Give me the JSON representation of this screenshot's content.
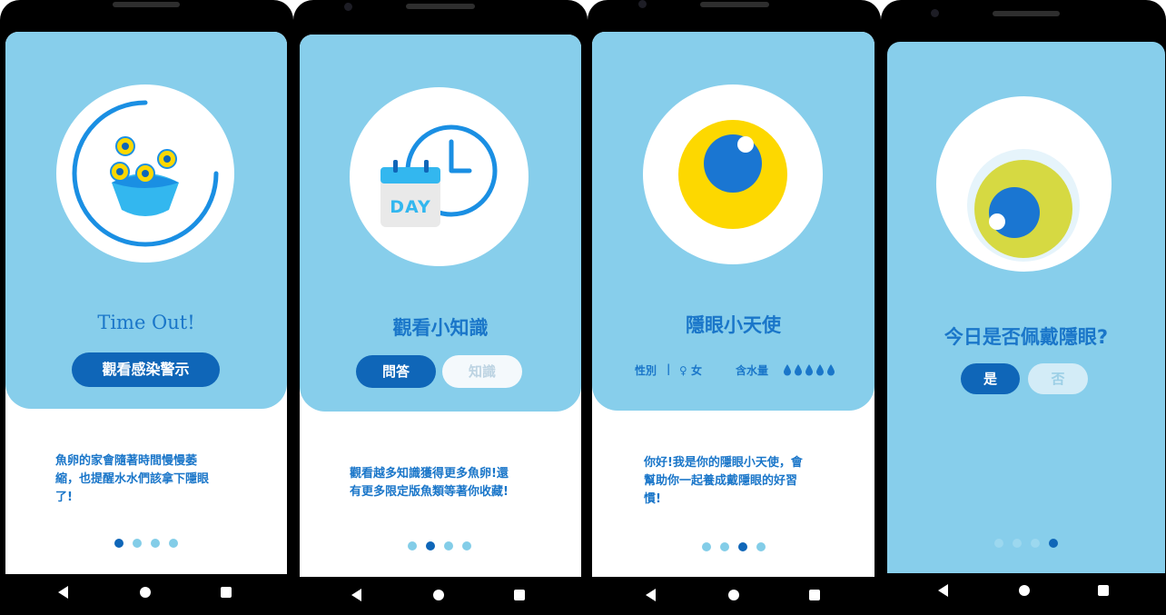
{
  "screens": [
    {
      "title": "Time Out!",
      "button": "觀看感染警示",
      "description": [
        "魚卵的家會隨著時間慢慢萎",
        "縮，也提醒水水們該拿下隱眼",
        "了!"
      ],
      "illustration": "fish-eggs-timer-icon",
      "active_page": 1
    },
    {
      "title": "觀看小知識",
      "buttons": [
        "問答",
        "知識"
      ],
      "description": [
        "觀看越多知識獲得更多魚卵!還",
        "有更多限定版魚類等著你收藏!"
      ],
      "calendar_label": "DAY",
      "illustration": "calendar-clock-icon",
      "active_page": 2
    },
    {
      "title": "隱眼小天使",
      "gender_label": "性別",
      "gender_value": "♀ 女",
      "water_label": "含水量",
      "water_drops": "💧💧💧💧💧",
      "description": [
        "你好!我是你的隱眼小天使，會",
        "幫助你一起養成戴隱眼的好習",
        "慣!"
      ],
      "illustration": "eye-icon",
      "active_page": 3
    },
    {
      "title": "今日是否佩戴隱眼?",
      "buttons": [
        "是",
        "否"
      ],
      "illustration": "contact-lens-eye-icon",
      "active_page": 4
    }
  ],
  "colors": {
    "sky": "#87ceeb",
    "primary": "#0f66b8",
    "text": "#1a76c9",
    "yellow": "#fdd800",
    "lens_yellow": "#d6d942"
  },
  "nav_icons": [
    "back-icon",
    "home-icon",
    "recents-icon"
  ]
}
